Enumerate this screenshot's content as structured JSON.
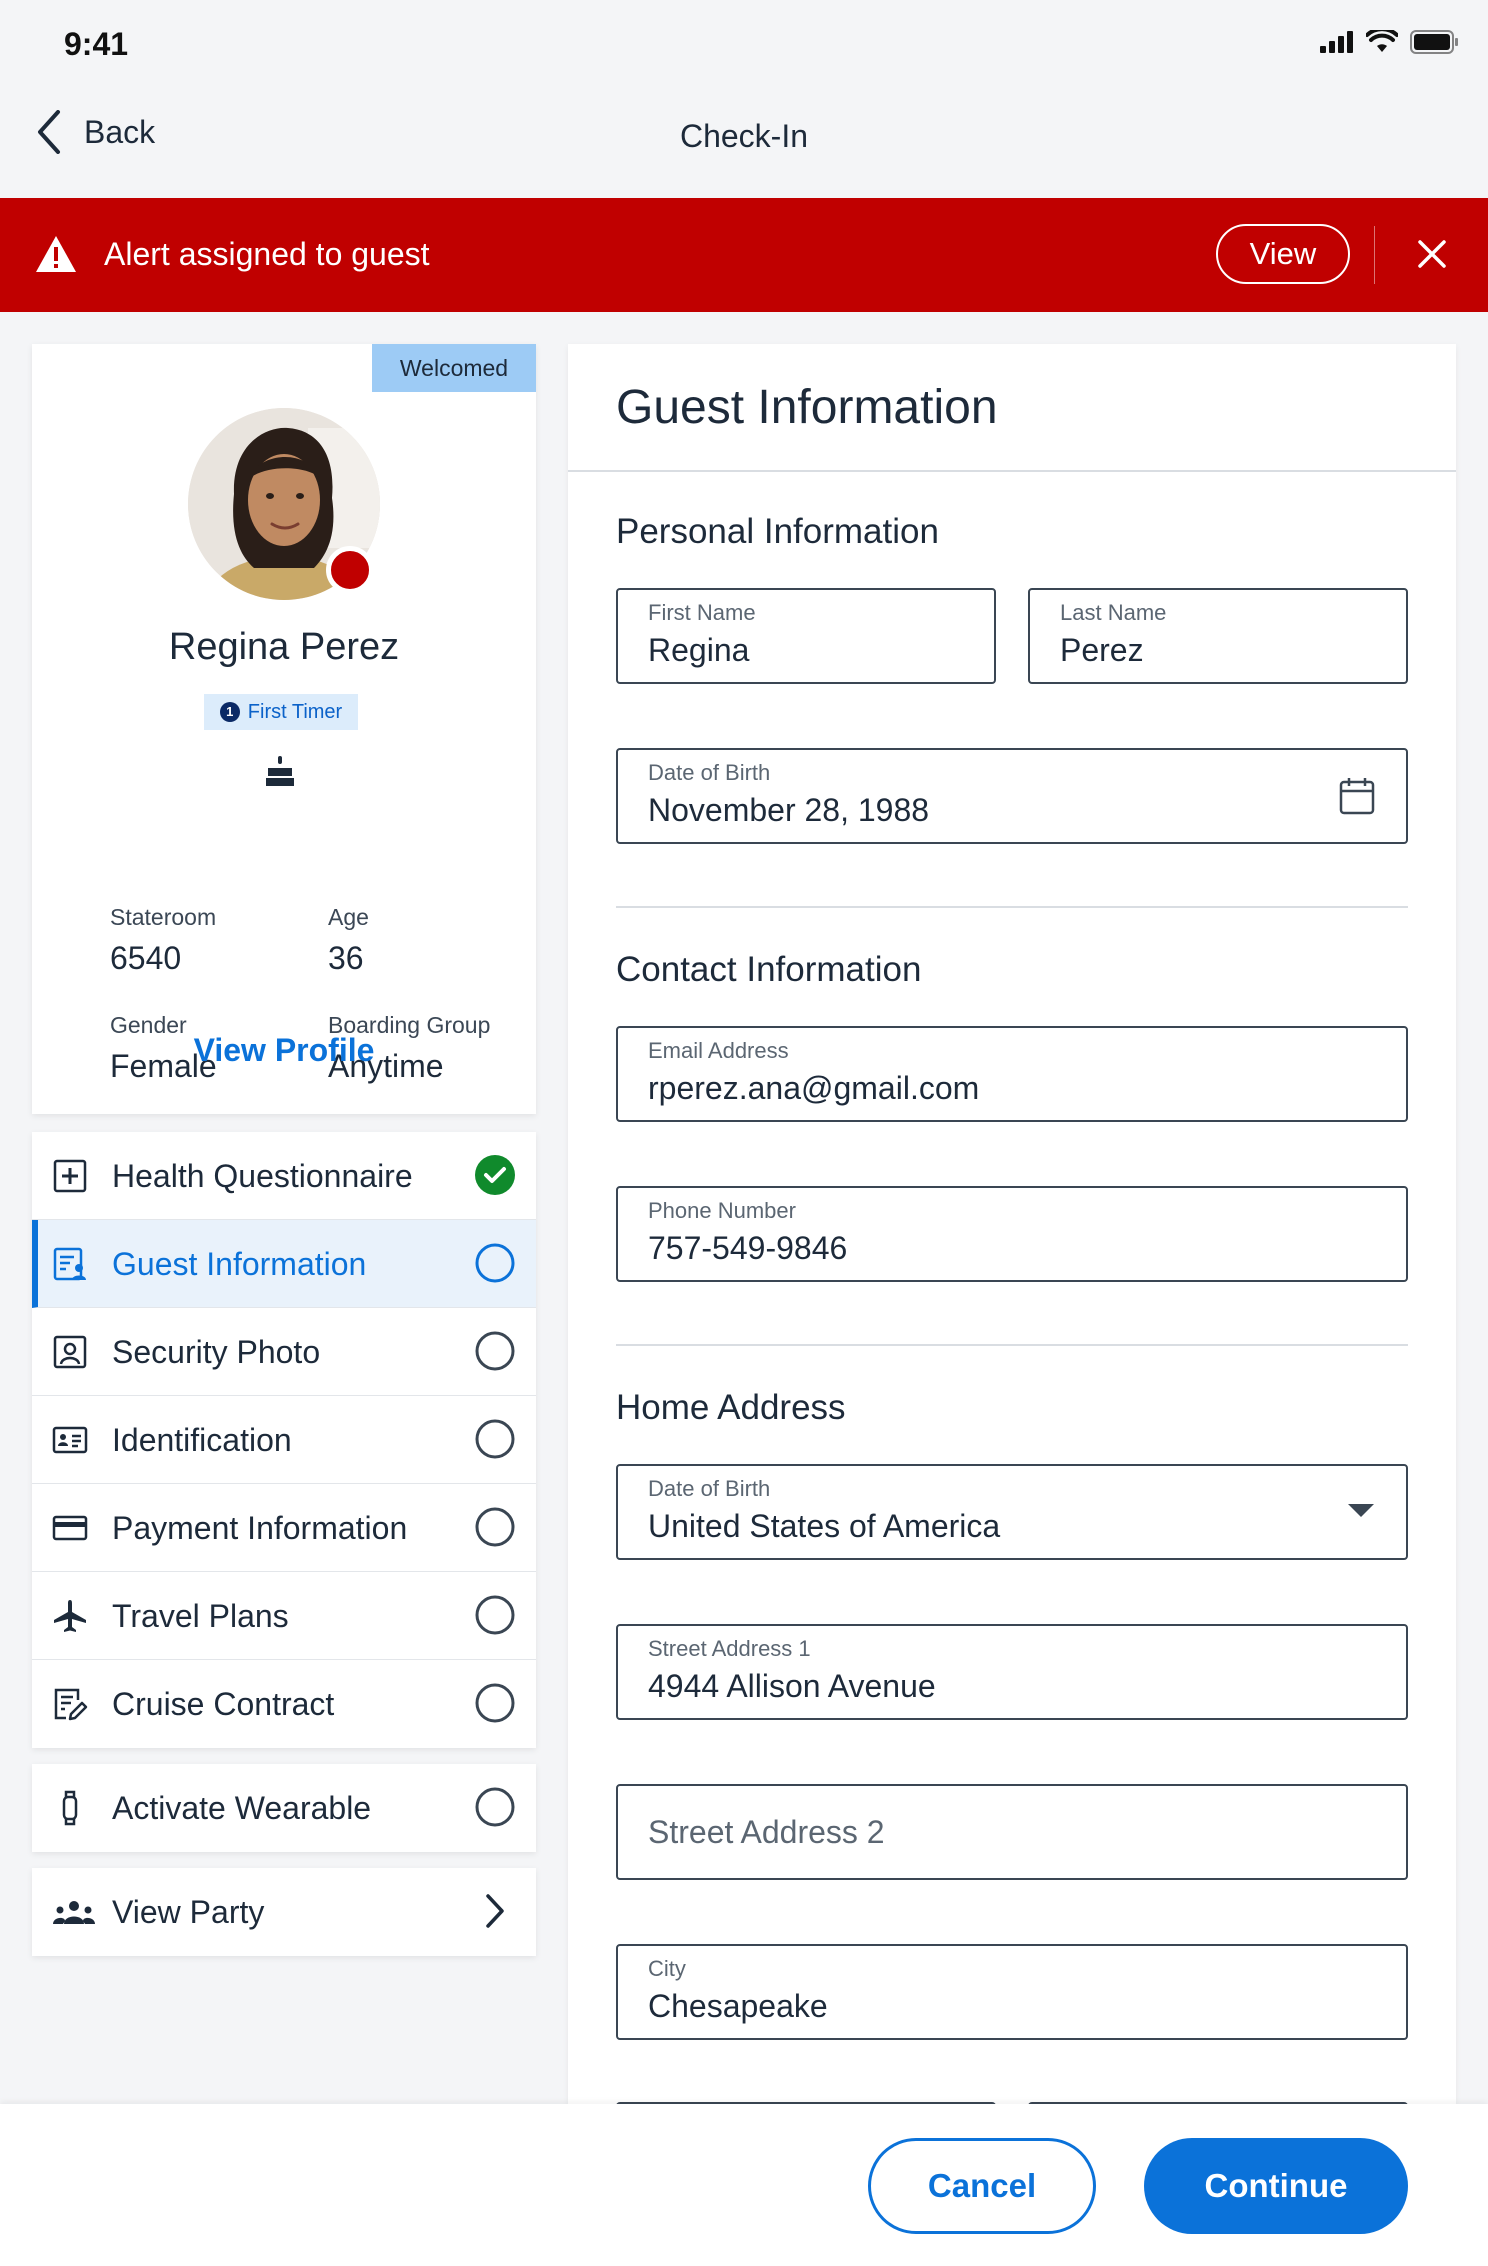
{
  "status_bar": {
    "time": "9:41"
  },
  "nav": {
    "back_label": "Back",
    "title": "Check-In"
  },
  "alert": {
    "message": "Alert assigned to guest",
    "view_label": "View"
  },
  "profile": {
    "badge": "Welcomed",
    "name": "Regina Perez",
    "tag": "First Timer",
    "tag_number": "1",
    "stateroom_label": "Stateroom",
    "stateroom_value": "6540",
    "age_label": "Age",
    "age_value": "36",
    "gender_label": "Gender",
    "gender_value": "Female",
    "boarding_label": "Boarding Group",
    "boarding_value": "Anytime",
    "view_profile_label": "View Profile"
  },
  "steps": [
    {
      "label": "Health Questionnaire",
      "icon": "medical-plus-icon",
      "status": "complete"
    },
    {
      "label": "Guest Information",
      "icon": "guest-info-icon",
      "status": "active"
    },
    {
      "label": "Security Photo",
      "icon": "portrait-icon",
      "status": "incomplete"
    },
    {
      "label": "Identification",
      "icon": "id-card-icon",
      "status": "incomplete"
    },
    {
      "label": "Payment Information",
      "icon": "credit-card-icon",
      "status": "incomplete"
    },
    {
      "label": "Travel Plans",
      "icon": "airplane-icon",
      "status": "incomplete"
    },
    {
      "label": "Cruise Contract",
      "icon": "contract-icon",
      "status": "incomplete"
    }
  ],
  "wearable": {
    "label": "Activate Wearable",
    "icon": "wearable-icon"
  },
  "party": {
    "label": "View Party",
    "icon": "group-icon"
  },
  "form": {
    "title": "Guest Information",
    "personal": {
      "heading": "Personal Information",
      "first_name_label": "First Name",
      "first_name_value": "Regina",
      "last_name_label": "Last Name",
      "last_name_value": "Perez",
      "dob_label": "Date of Birth",
      "dob_value": "November 28, 1988"
    },
    "contact": {
      "heading": "Contact Information",
      "email_label": "Email Address",
      "email_value": "rperez.ana@gmail.com",
      "phone_label": "Phone Number",
      "phone_value": "757-549-9846"
    },
    "address": {
      "heading": "Home Address",
      "country_label": "Date of Birth",
      "country_value": "United States of America",
      "street1_label": "Street Address 1",
      "street1_value": "4944 Allison Avenue",
      "street2_placeholder": "Street Address 2",
      "city_label": "City",
      "city_value": "Chesapeake"
    }
  },
  "actions": {
    "cancel_label": "Cancel",
    "continue_label": "Continue"
  },
  "colors": {
    "accent": "#0b72d9",
    "alert": "#c00000",
    "success": "#108a2c",
    "badge": "#9dcbf5"
  }
}
